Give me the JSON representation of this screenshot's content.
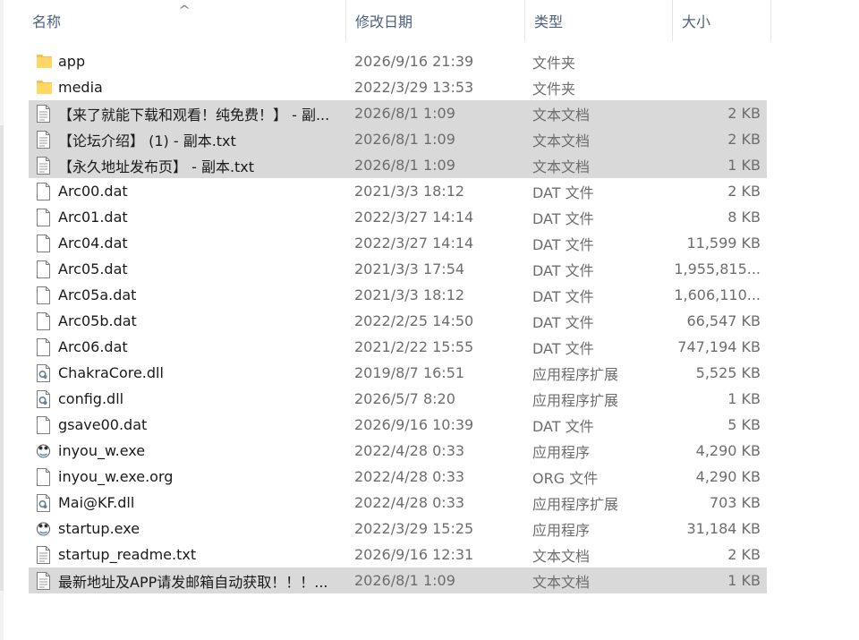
{
  "columns": {
    "name": "名称",
    "date": "修改日期",
    "type": "类型",
    "size": "大小"
  },
  "sort_icon": "chevron-up-icon",
  "files": [
    {
      "name": "app",
      "date": "2026/9/16 21:39",
      "type": "文件夹",
      "size": "",
      "icon": "folder-icon",
      "selected": false
    },
    {
      "name": "media",
      "date": "2022/3/29 13:53",
      "type": "文件夹",
      "size": "",
      "icon": "folder-icon",
      "selected": false
    },
    {
      "name": "【来了就能下载和观看！纯免费！】 - 副...",
      "date": "2026/8/1 1:09",
      "type": "文本文档",
      "size": "2 KB",
      "icon": "text-file-icon",
      "selected": true
    },
    {
      "name": "【论坛介绍】 (1) - 副本.txt",
      "date": "2026/8/1 1:09",
      "type": "文本文档",
      "size": "2 KB",
      "icon": "text-file-icon",
      "selected": true
    },
    {
      "name": "【永久地址发布页】 - 副本.txt",
      "date": "2026/8/1 1:09",
      "type": "文本文档",
      "size": "1 KB",
      "icon": "text-file-icon",
      "selected": true
    },
    {
      "name": "Arc00.dat",
      "date": "2021/3/3 18:12",
      "type": "DAT 文件",
      "size": "2 KB",
      "icon": "file-icon",
      "selected": false
    },
    {
      "name": "Arc01.dat",
      "date": "2022/3/27 14:14",
      "type": "DAT 文件",
      "size": "8 KB",
      "icon": "file-icon",
      "selected": false
    },
    {
      "name": "Arc04.dat",
      "date": "2022/3/27 14:14",
      "type": "DAT 文件",
      "size": "11,599 KB",
      "icon": "file-icon",
      "selected": false
    },
    {
      "name": "Arc05.dat",
      "date": "2021/3/3 17:54",
      "type": "DAT 文件",
      "size": "1,955,815...",
      "icon": "file-icon",
      "selected": false
    },
    {
      "name": "Arc05a.dat",
      "date": "2021/3/3 18:12",
      "type": "DAT 文件",
      "size": "1,606,110...",
      "icon": "file-icon",
      "selected": false
    },
    {
      "name": "Arc05b.dat",
      "date": "2022/2/25 14:50",
      "type": "DAT 文件",
      "size": "66,547 KB",
      "icon": "file-icon",
      "selected": false
    },
    {
      "name": "Arc06.dat",
      "date": "2021/2/22 15:55",
      "type": "DAT 文件",
      "size": "747,194 KB",
      "icon": "file-icon",
      "selected": false
    },
    {
      "name": "ChakraCore.dll",
      "date": "2019/8/7 16:51",
      "type": "应用程序扩展",
      "size": "5,525 KB",
      "icon": "dll-icon",
      "selected": false
    },
    {
      "name": "config.dll",
      "date": "2026/5/7 8:20",
      "type": "应用程序扩展",
      "size": "1 KB",
      "icon": "dll-icon",
      "selected": false
    },
    {
      "name": "gsave00.dat",
      "date": "2026/9/16 10:39",
      "type": "DAT 文件",
      "size": "5 KB",
      "icon": "file-icon",
      "selected": false
    },
    {
      "name": "inyou_w.exe",
      "date": "2022/4/28 0:33",
      "type": "应用程序",
      "size": "4,290 KB",
      "icon": "app-icon",
      "selected": false
    },
    {
      "name": "inyou_w.exe.org",
      "date": "2022/4/28 0:33",
      "type": "ORG 文件",
      "size": "4,290 KB",
      "icon": "file-icon",
      "selected": false
    },
    {
      "name": "Mai@KF.dll",
      "date": "2022/4/28 0:33",
      "type": "应用程序扩展",
      "size": "703 KB",
      "icon": "dll-icon",
      "selected": false
    },
    {
      "name": "startup.exe",
      "date": "2022/3/29 15:25",
      "type": "应用程序",
      "size": "31,184 KB",
      "icon": "app-icon",
      "selected": false
    },
    {
      "name": "startup_readme.txt",
      "date": "2026/9/16 12:31",
      "type": "文本文档",
      "size": "2 KB",
      "icon": "text-file-icon",
      "selected": false
    },
    {
      "name": "最新地址及APP请发邮箱自动获取！！！...",
      "date": "2026/8/1 1:09",
      "type": "文本文档",
      "size": "1 KB",
      "icon": "text-file-icon",
      "selected": true
    }
  ]
}
